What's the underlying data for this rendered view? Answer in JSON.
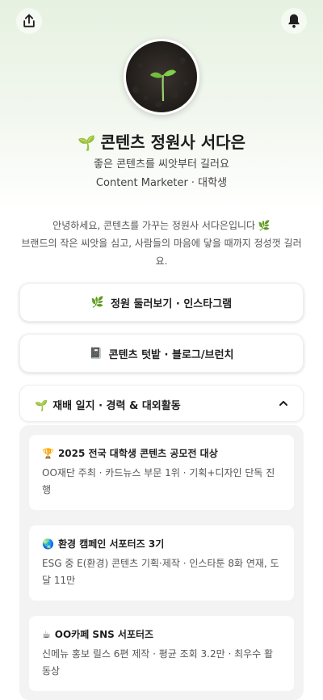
{
  "header": {
    "share_icon": "share-icon",
    "bell_icon": "bell-icon"
  },
  "profile": {
    "avatar_alt": "sprout-avatar",
    "emoji": "🌱",
    "name": "콘텐츠 정원사 서다은",
    "tagline": "좋은 콘텐츠를 씨앗부터 길러요",
    "role": "Content Marketer · 대학생"
  },
  "bio": {
    "line1": "안녕하세요, 콘텐츠를 가꾸는 정원사 서다은입니다 🌿",
    "line2": "브랜드의 작은 씨앗을 심고, 사람들의 마음에 닿을 때까지 정성껏 길러요."
  },
  "links": [
    {
      "icon": "🌿",
      "label": "정원 둘러보기 · 인스타그램"
    },
    {
      "icon": "📓",
      "label": "콘텐츠 텃밭 · 블로그/브런치"
    }
  ],
  "accordion": {
    "icon": "🌱",
    "title": "재배 일지 · 경력 & 대외활동",
    "items": [
      {
        "icon": "🏆",
        "title": "2025 전국 대학생 콘텐츠 공모전 대상",
        "desc": "OO재단 주최 · 카드뉴스 부문 1위 · 기획+디자인 단독 진행"
      },
      {
        "icon": "🌏",
        "title": "환경 캠페인 서포터즈 3기",
        "desc": "ESG 중 E(환경) 콘텐츠 기획·제작 · 인스타툰 8화 연재, 도달 11만"
      },
      {
        "icon": "☕",
        "title": "OO카페 SNS 서포터즈",
        "desc": "신메뉴 홍보 릴스 6편 제작 · 평균 조회 3.2만 · 최우수 활동상"
      }
    ]
  },
  "colors": {
    "hero_top": "#e6f1e1",
    "accent": "#3f7d3a"
  }
}
